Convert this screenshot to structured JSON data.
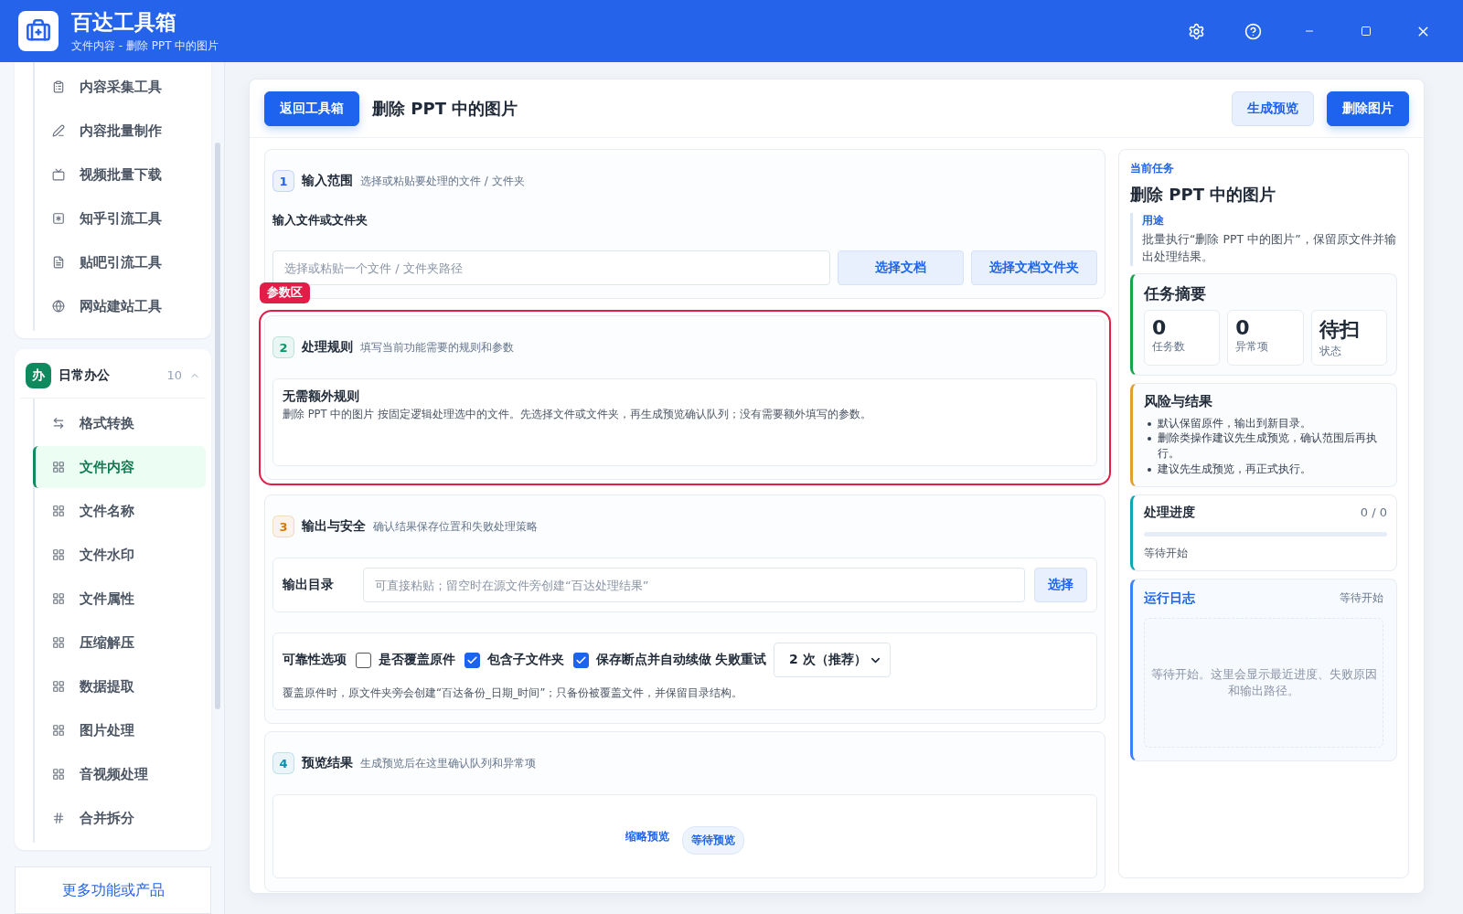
{
  "app": {
    "title": "百达工具箱",
    "subtitle": "文件内容 - 删除 PPT 中的图片"
  },
  "sidebar": {
    "groups": [
      {
        "items": [
          {
            "label": "内容采集工具",
            "kind": "form",
            "selected": false
          },
          {
            "label": "内容批量制作",
            "kind": "pen",
            "selected": false
          },
          {
            "label": "视频批量下载",
            "kind": "video",
            "selected": false
          },
          {
            "label": "知乎引流工具",
            "kind": "square",
            "selected": false
          },
          {
            "label": "贴吧引流工具",
            "kind": "note",
            "selected": false
          },
          {
            "label": "网站建站工具",
            "kind": "globe",
            "selected": false
          }
        ]
      },
      {
        "badge": "办",
        "title": "日常办公",
        "count": "10",
        "expanded": true,
        "items": [
          {
            "label": "格式转换",
            "kind": "swap",
            "selected": false
          },
          {
            "label": "文件内容",
            "kind": "grid",
            "selected": true
          },
          {
            "label": "文件名称",
            "kind": "grid",
            "selected": false
          },
          {
            "label": "文件水印",
            "kind": "grid",
            "selected": false
          },
          {
            "label": "文件属性",
            "kind": "grid",
            "selected": false
          },
          {
            "label": "压缩解压",
            "kind": "grid",
            "selected": false
          },
          {
            "label": "数据提取",
            "kind": "grid",
            "selected": false
          },
          {
            "label": "图片处理",
            "kind": "grid",
            "selected": false
          },
          {
            "label": "音视频处理",
            "kind": "grid",
            "selected": false
          },
          {
            "label": "合并拆分",
            "kind": "hash",
            "selected": false
          }
        ]
      }
    ],
    "more_link": "更多功能或产品"
  },
  "toolbar": {
    "back_button": "返回工具箱",
    "title": "删除 PPT 中的图片",
    "actions": [
      {
        "label": "生成预览",
        "primary": false
      },
      {
        "label": "删除图片",
        "primary": true
      }
    ]
  },
  "sections": [
    {
      "kind": "input",
      "number": "1",
      "title": "输入范围",
      "hint": "选择或粘贴要处理的文件 / 文件夹",
      "color": "#2563eb",
      "field_label": "输入文件或文件夹",
      "placeholder": "选择或粘贴一个文件 / 文件夹路径",
      "buttons": [
        "选择文档",
        "选择文档文件夹"
      ]
    },
    {
      "kind": "rules",
      "number": "2",
      "title": "处理规则",
      "hint": "填写当前功能需要的规则和参数",
      "color": "#059669",
      "highlight_label": "参数区",
      "rule_title": "无需额外规则",
      "rule_text": "删除 PPT 中的图片 按固定逻辑处理选中的文件。先选择文件或文件夹，再生成预览确认队列；没有需要额外填写的参数。"
    },
    {
      "kind": "output",
      "number": "3",
      "title": "输出与安全",
      "hint": "确认结果保存位置和失败处理策略",
      "color": "#d97706",
      "dir_label": "输出目录",
      "placeholder": "可直接粘贴；留空时在源文件旁创建“百达处理结果”",
      "choose_button": "选择",
      "options_label": "可靠性选项",
      "options": [
        {
          "label": "是否覆盖原件",
          "checked": false
        },
        {
          "label": "包含子文件夹",
          "checked": true
        },
        {
          "label": "保存断点并自动续做",
          "checked": true
        }
      ],
      "retry_label": "失败重试",
      "retry_value": "2 次（推荐）",
      "note": "覆盖原件时，原文件夹旁会创建“百达备份_日期_时间”；只备份被覆盖文件，并保留目录结构。"
    },
    {
      "kind": "preview",
      "number": "4",
      "title": "预览结果",
      "hint": "生成预览后在这里确认队列和异常项",
      "color": "#0891b2",
      "link": "缩略预览",
      "status": "等待预览"
    }
  ],
  "task": {
    "label": "当前任务",
    "title": "删除 PPT 中的图片",
    "purpose_label": "用途",
    "purpose_text": "批量执行“删除 PPT 中的图片”，保留原文件并输出处理结果。",
    "summary": {
      "title": "任务摘要",
      "stats": [
        {
          "value": "0",
          "label": "任务数"
        },
        {
          "value": "0",
          "label": "异常项"
        },
        {
          "value": "待扫",
          "label": "状态"
        }
      ]
    },
    "risks": {
      "title": "风险与结果",
      "items": [
        "默认保留原件，输出到新目录。",
        "删除类操作建议先生成预览，确认范围后再执行。",
        "建议先生成预览，再正式执行。"
      ]
    },
    "progress": {
      "title": "处理进度",
      "reading": "0 / 0",
      "level": 0,
      "status": "等待开始"
    },
    "log": {
      "title": "运行日志",
      "status": "等待开始",
      "text": "等待开始。这里会显示最近进度、失败原因和输出路径。"
    }
  }
}
